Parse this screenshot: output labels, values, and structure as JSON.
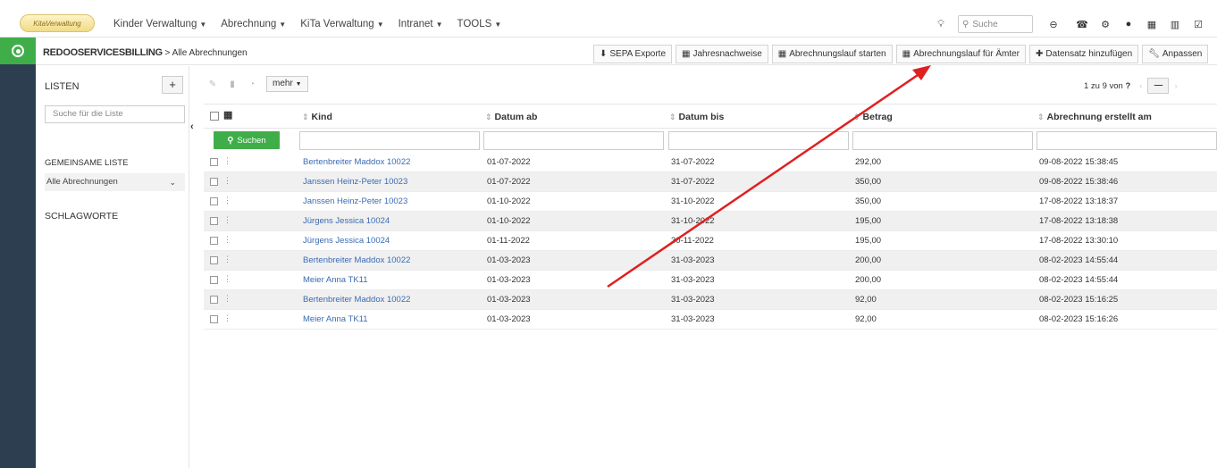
{
  "app": {
    "logo_text": "KitaVerwaltung"
  },
  "nav": {
    "menu": [
      {
        "label": "Kinder Verwaltung"
      },
      {
        "label": "Abrechnung"
      },
      {
        "label": "KiTa Verwaltung"
      },
      {
        "label": "Intranet"
      },
      {
        "label": "TOOLS"
      }
    ],
    "search_placeholder": "Suche",
    "icons": [
      "lightbulb-icon",
      "search-icon",
      "refresh-icon",
      "phone-icon",
      "gear-icon",
      "help-icon",
      "calendar-icon",
      "chart-icon",
      "checkbox-icon"
    ]
  },
  "breadcrumb": {
    "module": "REDOOSERVICESBILLING",
    "separator": ">",
    "page": "Alle Abrechnungen"
  },
  "toolbar": {
    "sepa": "SEPA Exporte",
    "jahres": "Jahresnachweise",
    "lauf": "Abrechnungslauf starten",
    "aemter": "Abrechnungslauf für Ämter",
    "add": "Datensatz hinzufügen",
    "anpassen": "Anpassen"
  },
  "left": {
    "lists_title": "LISTEN",
    "add_symbol": "+",
    "search_placeholder": "Suche für die Liste",
    "shared_title": "GEMEINSAME LISTE",
    "selected_list": "Alle Abrechnungen",
    "tags_title": "SCHLAGWORTE"
  },
  "actions": {
    "more": "mehr"
  },
  "pager": {
    "text": "1 zu 9 von",
    "total": "?"
  },
  "table": {
    "columns": [
      "Kind",
      "Datum ab",
      "Datum bis",
      "Betrag",
      "Abrechnung erstellt am"
    ],
    "search_button": "Suchen",
    "rows": [
      {
        "kind": "Bertenbreiter Maddox 10022",
        "ab": "01-07-2022",
        "bis": "31-07-2022",
        "betrag": "292,00",
        "erstellt": "09-08-2022 15:38:45"
      },
      {
        "kind": "Janssen Heinz-Peter 10023",
        "ab": "01-07-2022",
        "bis": "31-07-2022",
        "betrag": "350,00",
        "erstellt": "09-08-2022 15:38:46"
      },
      {
        "kind": "Janssen Heinz-Peter 10023",
        "ab": "01-10-2022",
        "bis": "31-10-2022",
        "betrag": "350,00",
        "erstellt": "17-08-2022 13:18:37"
      },
      {
        "kind": "Jürgens Jessica 10024",
        "ab": "01-10-2022",
        "bis": "31-10-2022",
        "betrag": "195,00",
        "erstellt": "17-08-2022 13:18:38"
      },
      {
        "kind": "Jürgens Jessica 10024",
        "ab": "01-11-2022",
        "bis": "30-11-2022",
        "betrag": "195,00",
        "erstellt": "17-08-2022 13:30:10"
      },
      {
        "kind": "Bertenbreiter Maddox 10022",
        "ab": "01-03-2023",
        "bis": "31-03-2023",
        "betrag": "200,00",
        "erstellt": "08-02-2023 14:55:44"
      },
      {
        "kind": "Meier Anna TK11",
        "ab": "01-03-2023",
        "bis": "31-03-2023",
        "betrag": "200,00",
        "erstellt": "08-02-2023 14:55:44"
      },
      {
        "kind": "Bertenbreiter Maddox 10022",
        "ab": "01-03-2023",
        "bis": "31-03-2023",
        "betrag": "92,00",
        "erstellt": "08-02-2023 15:16:25"
      },
      {
        "kind": "Meier Anna TK11",
        "ab": "01-03-2023",
        "bis": "31-03-2023",
        "betrag": "92,00",
        "erstellt": "08-02-2023 15:16:26"
      }
    ]
  },
  "colors": {
    "accent_green": "#3fae49",
    "sidebar_dark": "#2c3e50",
    "link_blue": "#3a6bb3",
    "annotation_red": "#e02020"
  }
}
